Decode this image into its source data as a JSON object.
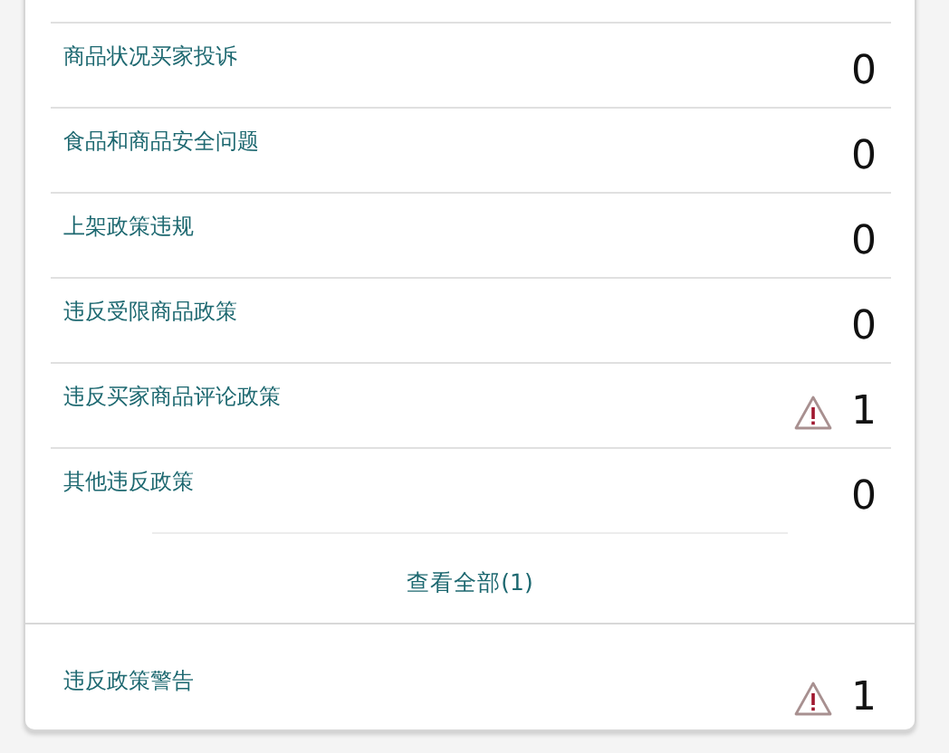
{
  "policy_rows": [
    {
      "label": "商品状况买家投诉",
      "count": "0",
      "warning": false
    },
    {
      "label": "食品和商品安全问题",
      "count": "0",
      "warning": false
    },
    {
      "label": "上架政策违规",
      "count": "0",
      "warning": false
    },
    {
      "label": "违反受限商品政策",
      "count": "0",
      "warning": false
    },
    {
      "label": "违反买家商品评论政策",
      "count": "1",
      "warning": true
    },
    {
      "label": "其他违反政策",
      "count": "0",
      "warning": false
    }
  ],
  "view_all": "查看全部(1)",
  "warning_row": {
    "label": "违反政策警告",
    "count": "1",
    "warning": true
  }
}
